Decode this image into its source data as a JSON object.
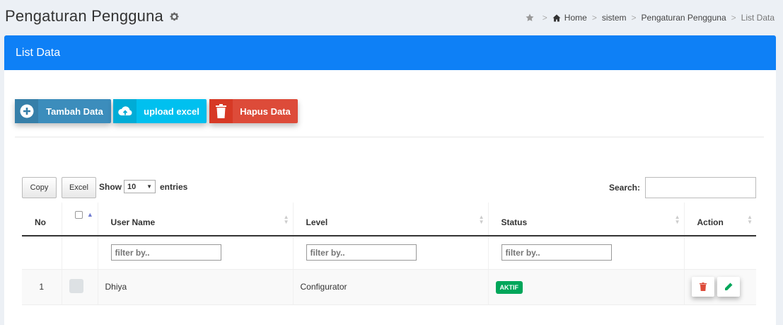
{
  "page": {
    "title": "Pengaturan Pengguna",
    "title_icon": "gear-icon"
  },
  "breadcrumb": {
    "items": [
      "Home",
      "sistem",
      "Pengaturan Pengguna",
      "List Data"
    ],
    "star_icon": "star-icon",
    "home_icon": "home-icon"
  },
  "panel": {
    "title": "List Data",
    "header_color": "#0e80f6"
  },
  "toolbar": {
    "add_label": "Tambah Data",
    "upload_label": "upload excel",
    "delete_label": "Hapus Data",
    "add_icon": "plus-circle-icon",
    "upload_icon": "cloud-upload-icon",
    "delete_icon": "trash-icon"
  },
  "datatable": {
    "copy_label": "Copy",
    "excel_label": "Excel",
    "show_label": "Show",
    "length_value": "10",
    "entries_label": "entries",
    "search_label": "Search:",
    "search_value": ""
  },
  "table": {
    "columns": [
      "No",
      "",
      "User Name",
      "Level",
      "Status",
      "Action"
    ],
    "filter_placeholder": "filter by..",
    "rows": [
      {
        "no": "1",
        "username": "Dhiya",
        "level": "Configurator",
        "status": "AKTIF"
      }
    ],
    "status_color": "#00a65a"
  }
}
